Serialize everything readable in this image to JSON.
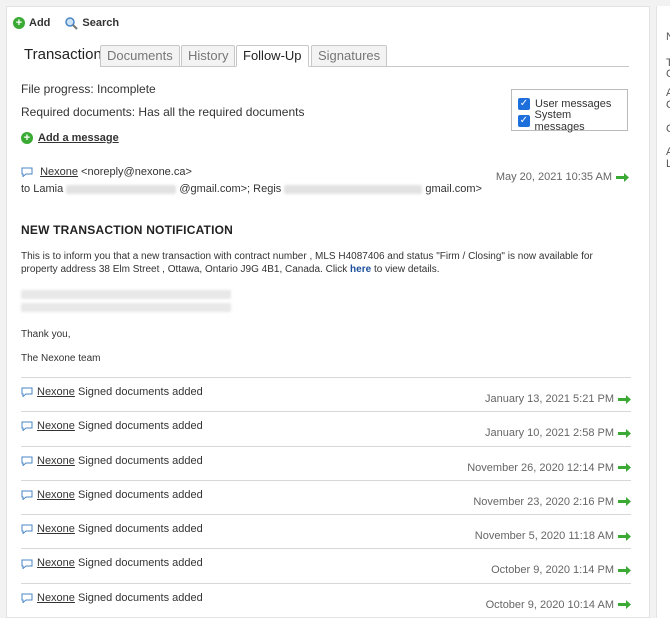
{
  "toolbar": {
    "add_label": "Add",
    "search_label": "Search"
  },
  "tabs": [
    {
      "label": "Transaction"
    },
    {
      "label": "Documents"
    },
    {
      "label": "History"
    },
    {
      "label": "Follow-Up"
    },
    {
      "label": "Signatures"
    }
  ],
  "file": {
    "progress_text": "File progress: Incomplete",
    "required_docs_text": "Required documents: Has all the required documents"
  },
  "filters": {
    "user_messages": "User messages",
    "system_messages": "System messages"
  },
  "add_message_label": "Add a message",
  "message": {
    "sender": "Nexone",
    "sender_email": "<noreply@nexone.ca>",
    "to_label": "to Lamia",
    "to_mid": "@gmail.com>; Regis",
    "to_end": "gmail.com>",
    "date": "May 20, 2021 10:35 AM",
    "title": "NEW TRANSACTION NOTIFICATION",
    "body_before": "This is to inform you that a new transaction with contract number , MLS H4087406 and status \"Firm / Closing\" is now available for property address 38 Elm Street , Ottawa, Ontario J9G 4B1, Canada. Click ",
    "link": "here",
    "body_after": " to view details.",
    "thanks": "Thank you,",
    "signature": "The Nexone team"
  },
  "history": [
    {
      "sender": "Nexone",
      "text": "Signed documents added",
      "date": "January 13, 2021 5:21 PM"
    },
    {
      "sender": "Nexone",
      "text": "Signed documents added",
      "date": "January 10, 2021 2:58 PM"
    },
    {
      "sender": "Nexone",
      "text": "Signed documents added",
      "date": "November 26, 2020 12:14 PM"
    },
    {
      "sender": "Nexone",
      "text": "Signed documents added",
      "date": "November 23, 2020 2:16 PM"
    },
    {
      "sender": "Nexone",
      "text": "Signed documents added",
      "date": "November 5, 2020 11:18 AM"
    },
    {
      "sender": "Nexone",
      "text": "Signed documents added",
      "date": "October 9, 2020 1:14 PM"
    },
    {
      "sender": "Nexone",
      "text": "Signed documents added",
      "date": "October 9, 2020 10:14 AM"
    }
  ],
  "right_panel": [
    "N",
    "T",
    "C",
    "A",
    "C",
    "C",
    "A",
    "L"
  ],
  "colors": {
    "accent_green": "#3aaa35",
    "checkbox_blue": "#1d6fdc",
    "link_blue": "#1b4f9c"
  }
}
